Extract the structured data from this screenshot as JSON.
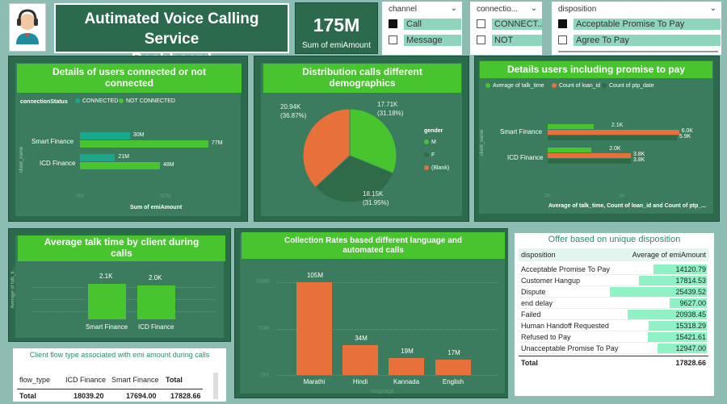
{
  "header": {
    "title_line1": "Autimated Voice Calling Service",
    "title_line2": "Dashboard",
    "kpi_value": "175M",
    "kpi_label": "Sum of emiAmount"
  },
  "slicers": {
    "channel": {
      "title": "channel",
      "options": [
        {
          "label": "Call",
          "checked": true
        },
        {
          "label": "Message",
          "checked": false
        }
      ]
    },
    "connection": {
      "title": "connectio...",
      "options": [
        {
          "label": "CONNECT...",
          "checked": false
        },
        {
          "label": "NOT CON...",
          "checked": false
        }
      ]
    },
    "disposition": {
      "title": "disposition",
      "options": [
        {
          "label": "Acceptable Promise To Pay",
          "checked": true
        },
        {
          "label": "Agree To Pay",
          "checked": false
        }
      ]
    }
  },
  "colors": {
    "green": "#47c42e",
    "teal": "#1aa88d",
    "orange": "#e8703a",
    "dark_green": "#2f6b48"
  },
  "connected_chart": {
    "title": "Details of users connected or not connected",
    "legend_title": "connectionStatus",
    "legend": [
      "CONNECTED",
      "NOT CONNECTED"
    ],
    "ylabel": "client_name",
    "xlabel": "Sum of emiAmount",
    "xticks": [
      "0M",
      "50M"
    ],
    "chart_data": {
      "type": "bar",
      "categories": [
        "Smart Finance",
        "ICD Finance"
      ],
      "series": [
        {
          "name": "CONNECTED",
          "values": [
            30,
            21
          ],
          "labels": [
            "30M",
            "21M"
          ]
        },
        {
          "name": "NOT CONNECTED",
          "values": [
            77,
            48
          ],
          "labels": [
            "77M",
            "48M"
          ]
        }
      ],
      "xlim": [
        0,
        80
      ]
    }
  },
  "pie_chart": {
    "title": "Distribution calls different demographics",
    "legend_title": "gender",
    "legend": [
      "M",
      "F",
      "(Blank)"
    ],
    "labels": [
      {
        "line1": "17.71K",
        "line2": "(31.18%)"
      },
      {
        "line1": "18.15K",
        "line2": "(31.95%)"
      },
      {
        "line1": "20.94K",
        "line2": "(36.87%)"
      }
    ],
    "chart_data": {
      "type": "pie",
      "categories": [
        "M",
        "F",
        "(Blank)"
      ],
      "values": [
        17710,
        18150,
        20940
      ],
      "percent": [
        31.18,
        31.95,
        36.87
      ]
    }
  },
  "ptp_chart": {
    "title": "Details users including promise to pay",
    "legend": [
      "Average of talk_time",
      "Count of loan_id",
      "Count of ptp_date"
    ],
    "ylabel": "client_name",
    "xlabel": "Average of talk_time, Count of loan_id and Count of ptp_...",
    "xticks": [
      "0K",
      "5K"
    ],
    "chart_data": {
      "type": "bar",
      "categories": [
        "Smart Finance",
        "ICD Finance"
      ],
      "series": [
        {
          "name": "Average of talk_time",
          "values": [
            2.1,
            2.0
          ],
          "labels": [
            "2.1K",
            "2.0K"
          ]
        },
        {
          "name": "Count of loan_id",
          "values": [
            6.0,
            3.8
          ],
          "labels": [
            "6.0K",
            "3.8K"
          ]
        },
        {
          "name": "Count of ptp_date",
          "values": [
            5.9,
            3.8
          ],
          "labels": [
            "5.9K",
            "3.8K"
          ]
        }
      ],
      "xlim": [
        0,
        6.2
      ]
    }
  },
  "talk_chart": {
    "title": "Average talk time by client during calls",
    "ylabel": "Average of talk_ti...",
    "chart_data": {
      "type": "bar",
      "categories": [
        "Smart Finance",
        "ICD Finance"
      ],
      "values": [
        2.1,
        2.0
      ],
      "labels": [
        "2.1K",
        "2.0K"
      ],
      "ylim": [
        0,
        2.3
      ]
    }
  },
  "lang_chart": {
    "title": "Collection Rates based different language and automated calls",
    "xlabel": "language",
    "yticks": [
      "0M",
      "50M",
      "100M"
    ],
    "chart_data": {
      "type": "bar",
      "categories": [
        "Marathi",
        "Hindi",
        "Kannada",
        "English"
      ],
      "values": [
        105,
        34,
        19,
        17
      ],
      "labels": [
        "105M",
        "34M",
        "19M",
        "17M"
      ],
      "ylim": [
        0,
        110
      ]
    }
  },
  "offer_table": {
    "title": "Offer based on unique disposition",
    "headers": [
      "disposition",
      "Average of emiAmount"
    ],
    "rows": [
      {
        "name": "Acceptable Promise To Pay",
        "value": "14120.79",
        "pct": 0.55
      },
      {
        "name": "Customer Hangup",
        "value": "17814.53",
        "pct": 0.7
      },
      {
        "name": "Dispute",
        "value": "25439.52",
        "pct": 1.0
      },
      {
        "name": "end delay",
        "value": "9627.00",
        "pct": 0.38
      },
      {
        "name": "Failed",
        "value": "20938.45",
        "pct": 0.82
      },
      {
        "name": "Human Handoff Requested",
        "value": "15318.29",
        "pct": 0.6
      },
      {
        "name": "Refused to Pay",
        "value": "15421.61",
        "pct": 0.61
      },
      {
        "name": "Unacceptable Promise To Pay",
        "value": "12947.00",
        "pct": 0.51
      }
    ],
    "total_label": "Total",
    "total_value": "17828.66"
  },
  "flow_table": {
    "title": "Client flow type associated with emi amount during calls",
    "headers": [
      "flow_type",
      "ICD Finance",
      "Smart Finance",
      "Total"
    ],
    "total_row": [
      "Total",
      "18039.20",
      "17694.00",
      "17828.66"
    ]
  }
}
